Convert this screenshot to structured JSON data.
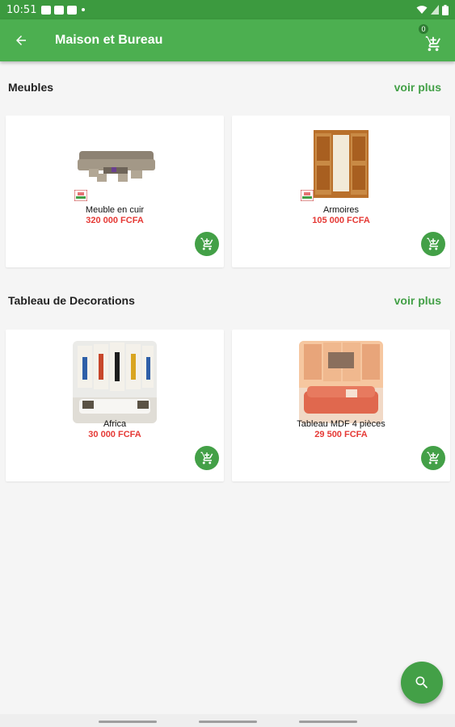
{
  "status_bar": {
    "time": "10:51"
  },
  "app_bar": {
    "title": "Maison et Bureau",
    "cart_count": "0"
  },
  "sections": [
    {
      "title": "Meubles",
      "see_more": "voir plus",
      "products": [
        {
          "name": "Meuble en cuir",
          "price": "320 000 FCFA"
        },
        {
          "name": "Armoires",
          "price": "105 000 FCFA"
        }
      ]
    },
    {
      "title": "Tableau de Decorations",
      "see_more": "voir plus",
      "products": [
        {
          "name": "Africa",
          "price": "30 000 FCFA"
        },
        {
          "name": "Tableau MDF 4 pièces",
          "price": "29 500 FCFA"
        }
      ]
    }
  ],
  "colors": {
    "primary": "#4caf50",
    "status_bar": "#3c9a3f",
    "accent": "#43a047",
    "price": "#e53935"
  },
  "icons": {
    "back": "arrow-left-icon",
    "cart": "cart-icon",
    "add_cart": "add-to-cart-icon",
    "search": "search-icon"
  }
}
